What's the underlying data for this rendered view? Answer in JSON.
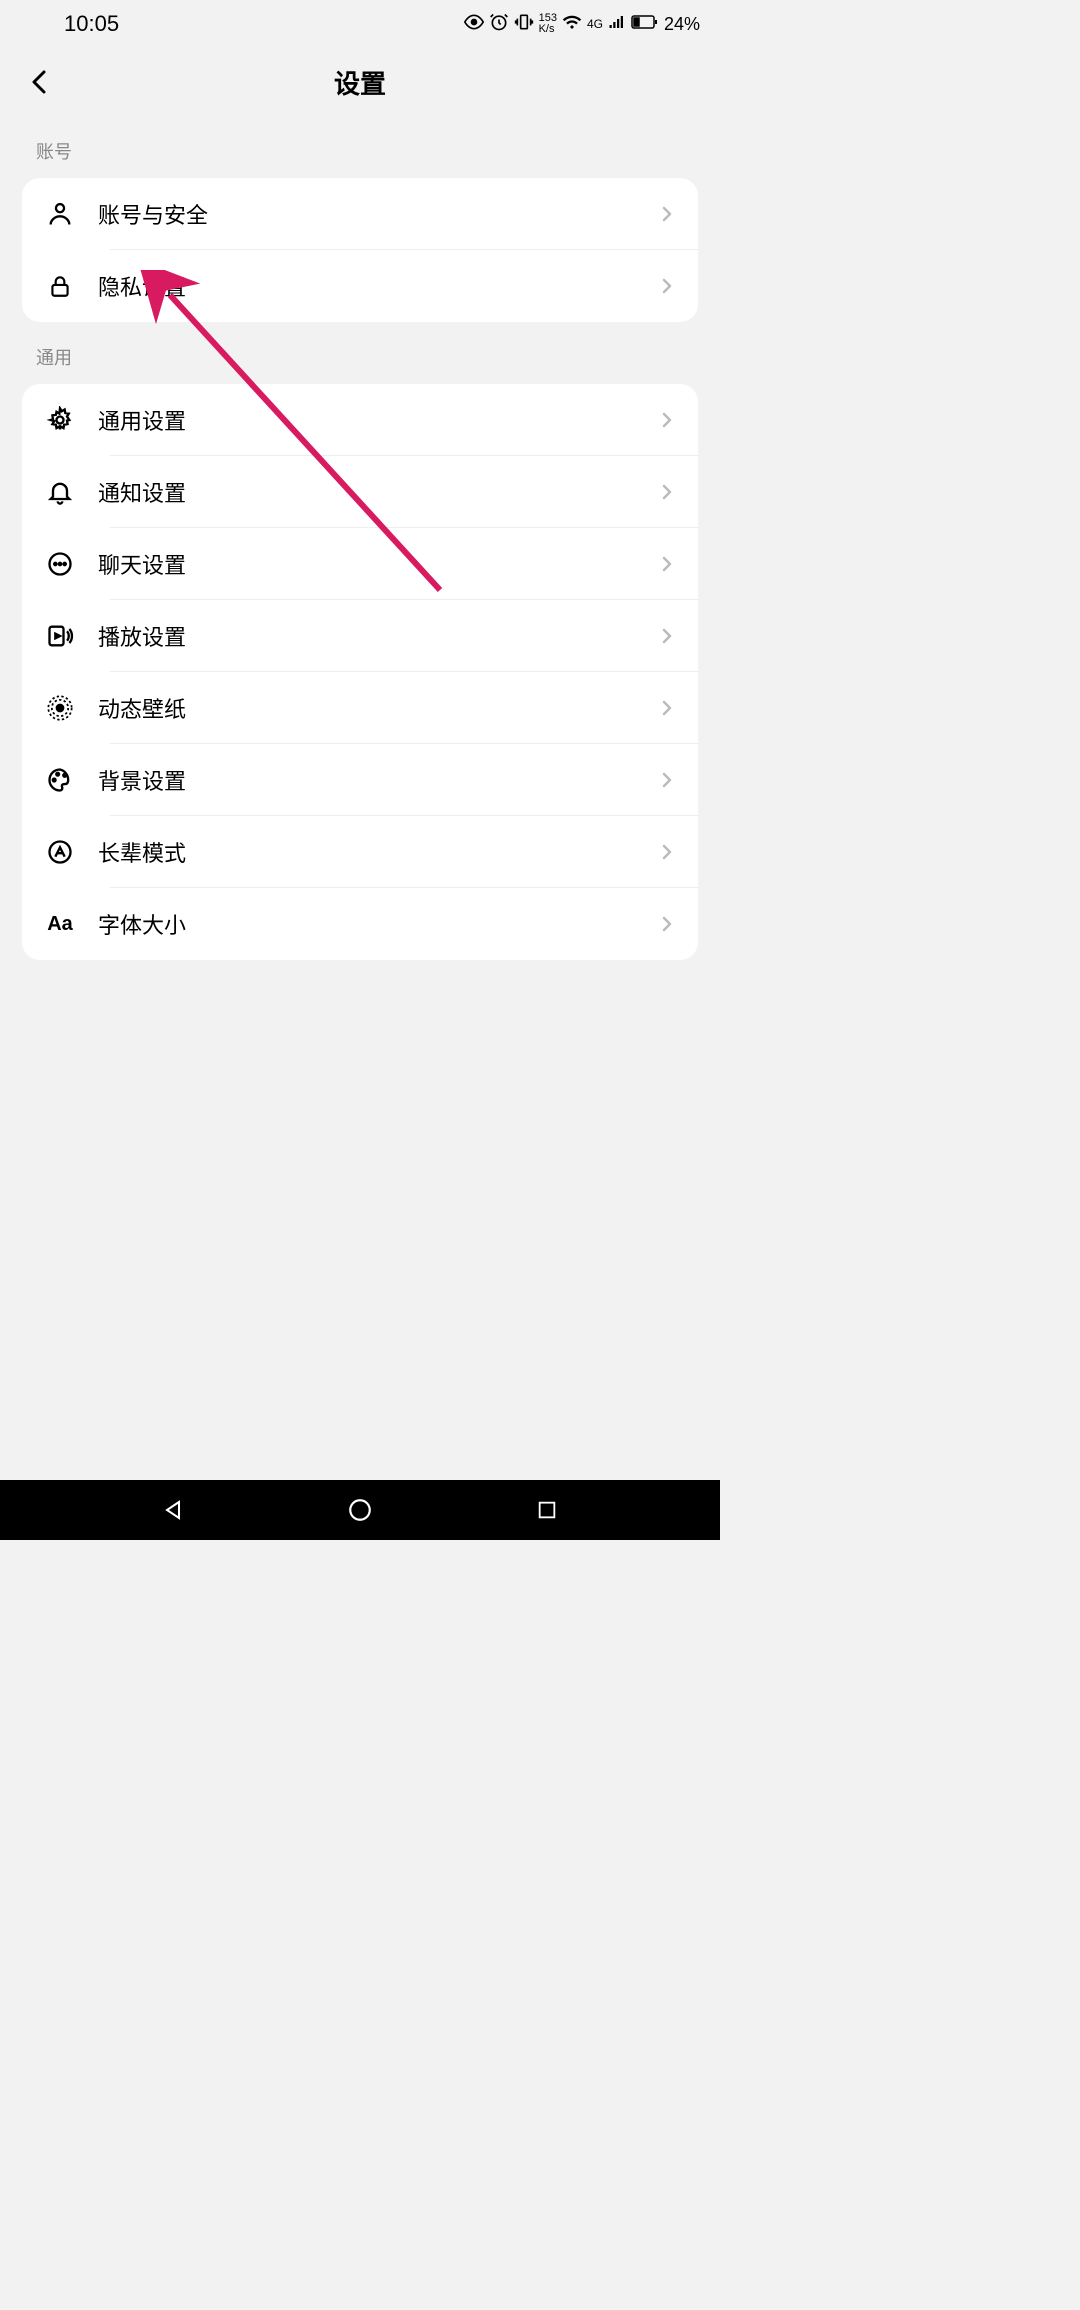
{
  "status": {
    "time": "10:05",
    "speed_value": "153",
    "speed_unit": "K/s",
    "network": "4G",
    "battery": "24%"
  },
  "header": {
    "title": "设置"
  },
  "sections": [
    {
      "header": "账号",
      "items": [
        {
          "icon": "user-icon",
          "label": "账号与安全"
        },
        {
          "icon": "lock-icon",
          "label": "隐私设置"
        }
      ]
    },
    {
      "header": "通用",
      "items": [
        {
          "icon": "gear-icon",
          "label": "通用设置"
        },
        {
          "icon": "bell-icon",
          "label": "通知设置"
        },
        {
          "icon": "chat-icon",
          "label": "聊天设置"
        },
        {
          "icon": "play-icon",
          "label": "播放设置"
        },
        {
          "icon": "wallpaper-icon",
          "label": "动态壁纸"
        },
        {
          "icon": "palette-icon",
          "label": "背景设置"
        },
        {
          "icon": "elder-icon",
          "label": "长辈模式"
        },
        {
          "icon": "font-icon",
          "label": "字体大小"
        }
      ]
    }
  ],
  "annotation": {
    "arrow_color": "#d81b60"
  }
}
